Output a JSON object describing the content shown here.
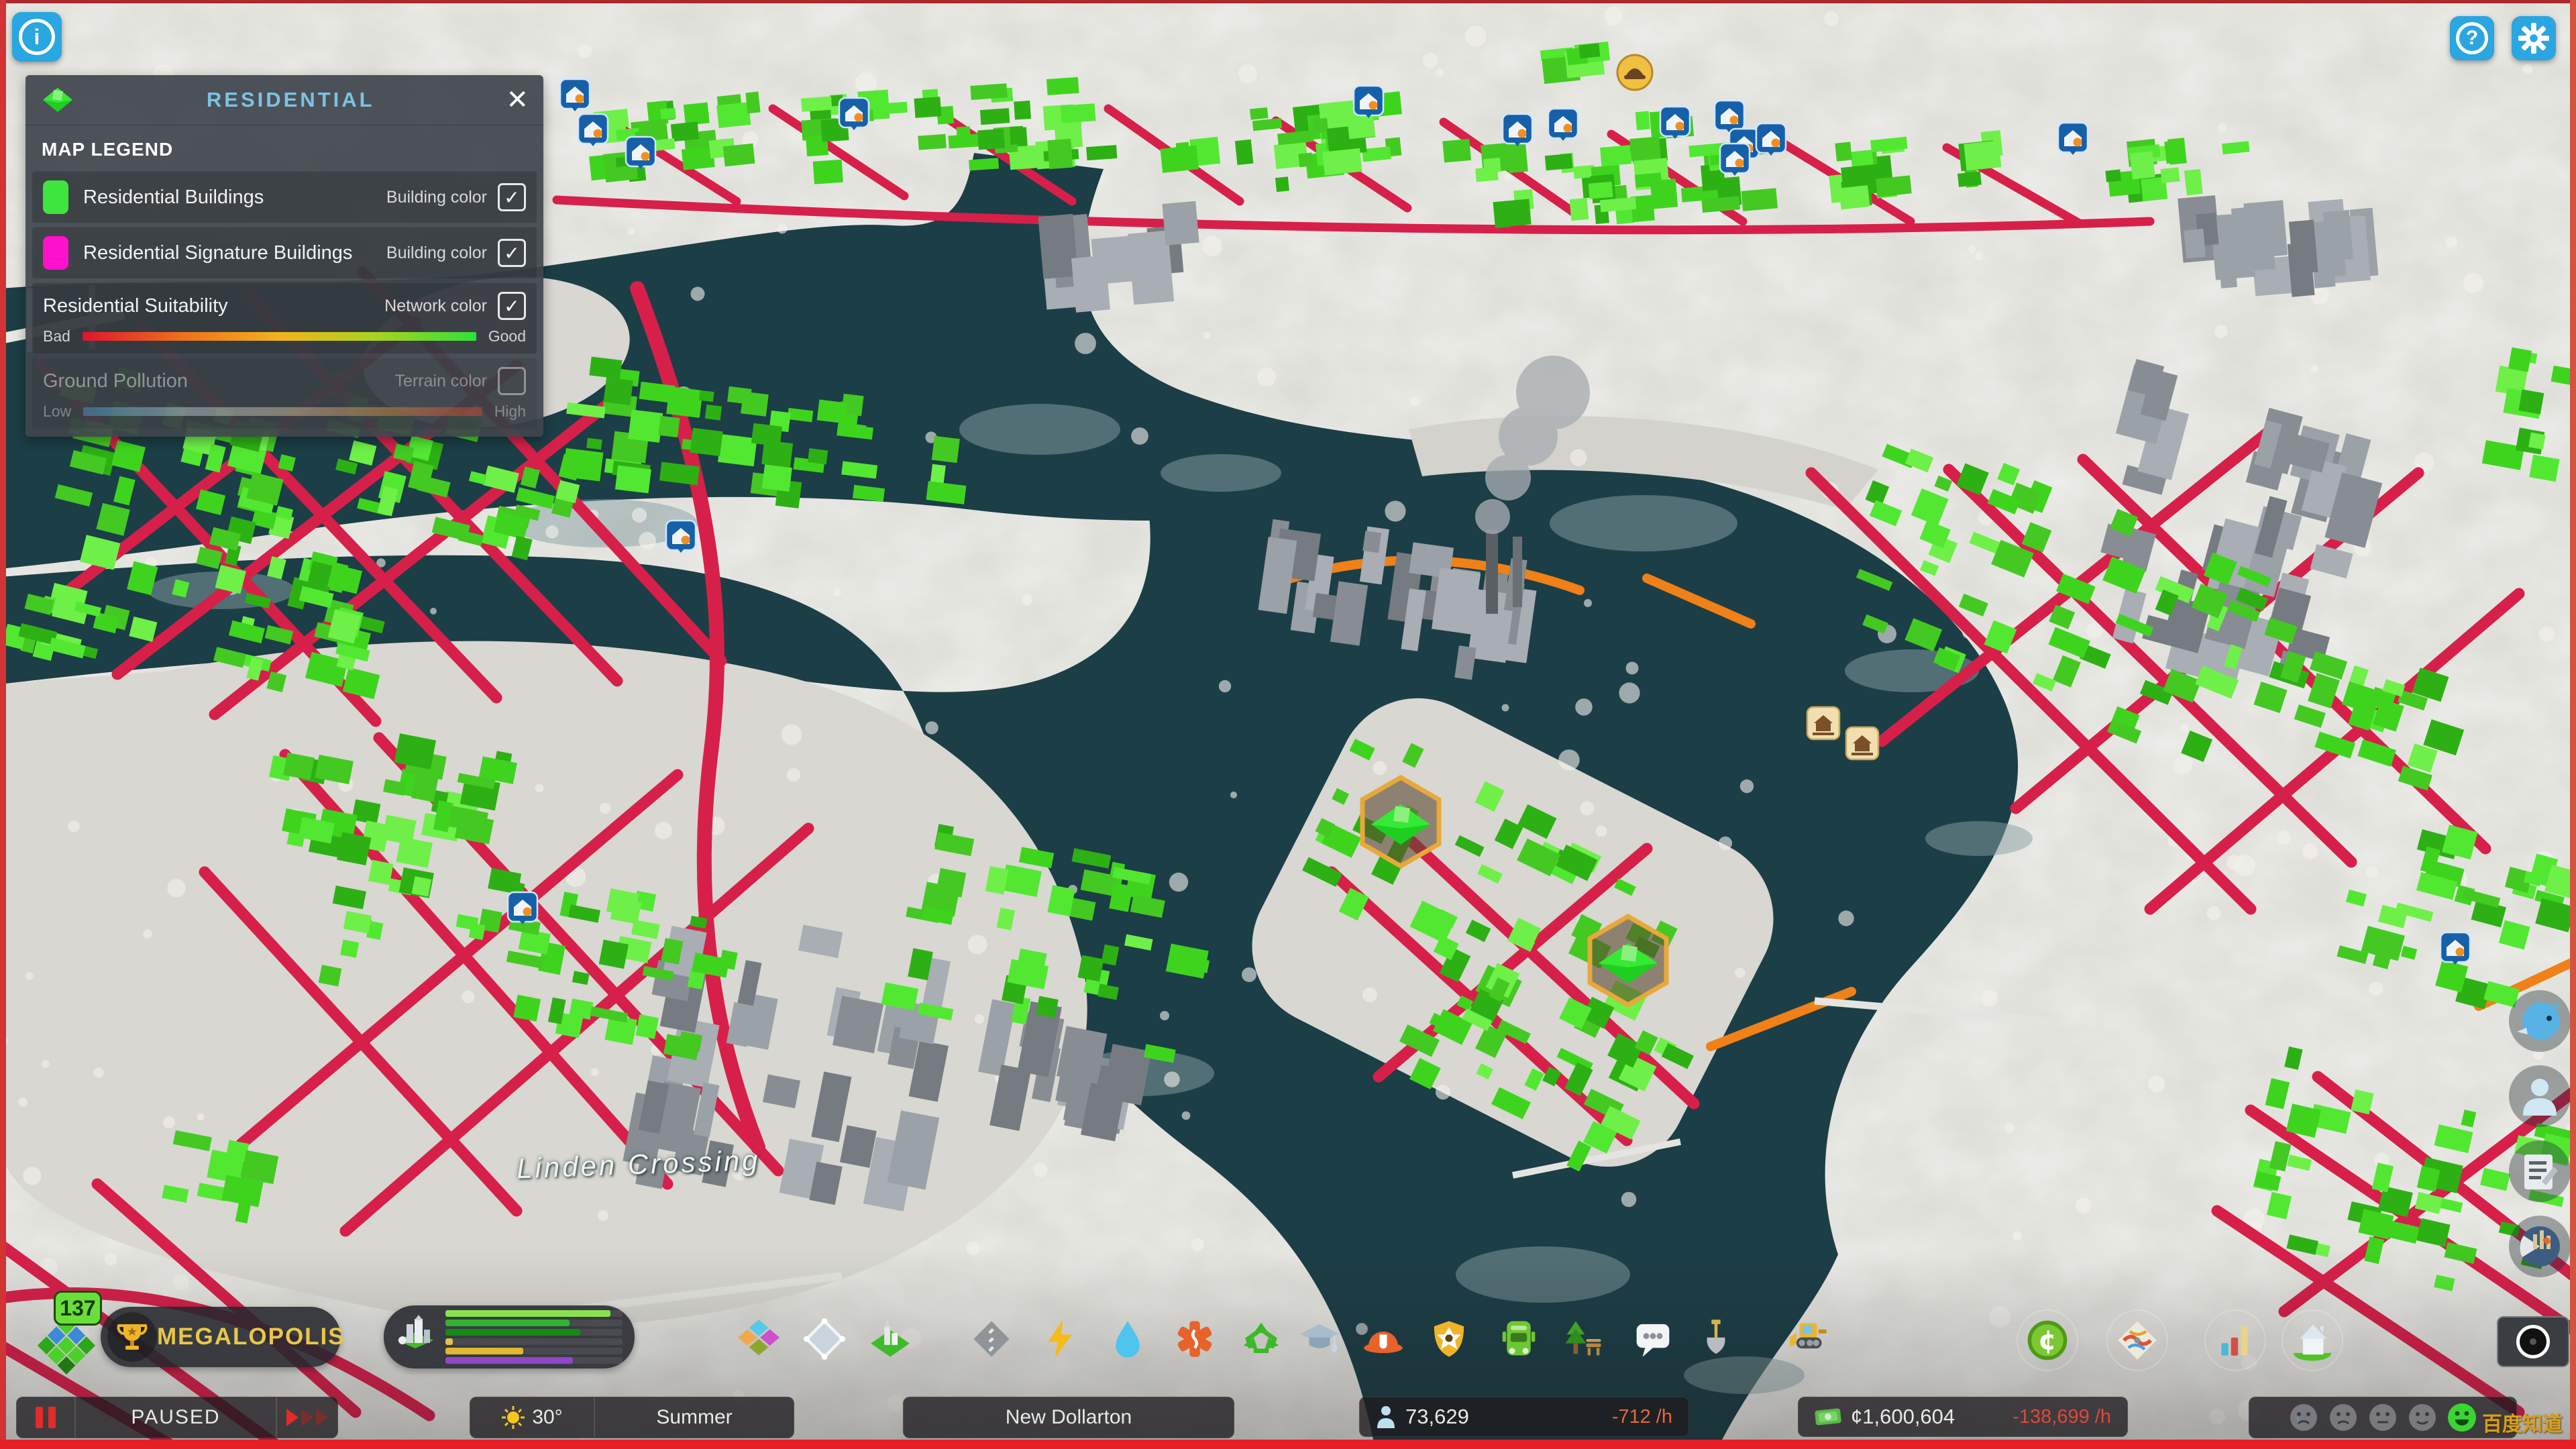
{
  "infoview_panel": {
    "title": "RESIDENTIAL",
    "section_heading": "MAP LEGEND",
    "close_glyph": "✕",
    "rows": {
      "r1": {
        "label": "Residential Buildings",
        "mode": "Building color",
        "check": "✓",
        "swatch": "#3fe53f"
      },
      "r2": {
        "label": "Residential Signature Buildings",
        "mode": "Building color",
        "check": "✓",
        "swatch": "#ff10cc"
      },
      "r3": {
        "label": "Residential Suitability",
        "mode": "Network color",
        "check": "✓",
        "scale_left": "Bad",
        "scale_right": "Good",
        "gradient": [
          "#de1530",
          "#ee6f1c",
          "#f2b31c",
          "#a6d41e",
          "#2fe03c"
        ]
      },
      "r4": {
        "label": "Ground Pollution",
        "mode": "Terrain color",
        "check": "",
        "scale_left": "Low",
        "scale_right": "High",
        "gradient": [
          "#3a9ad0",
          "#bdd2d8",
          "#d8c9a8",
          "#d98a40",
          "#d23c28"
        ]
      }
    }
  },
  "top_buttons": {
    "info_glyph": "i",
    "help_glyph": "?"
  },
  "map": {
    "district_label": "Linden Crossing"
  },
  "toolbar": {
    "tiles_count": "137",
    "milestone_label": "MEGALOPOLIS"
  },
  "demand": {
    "bars": [
      {
        "name": "residential-low",
        "color": "#86e24e",
        "value": 0.93
      },
      {
        "name": "residential-medium",
        "color": "#2fb52f",
        "value": 0.7
      },
      {
        "name": "residential-high",
        "color": "#168a16",
        "value": 0.76
      },
      {
        "name": "commercial",
        "color": "#d8c44e",
        "value": 0.04
      },
      {
        "name": "industrial",
        "color": "#e0b832",
        "value": 0.44
      },
      {
        "name": "office",
        "color": "#8f46c8",
        "value": 0.72
      }
    ]
  },
  "statusbar": {
    "paused_label": "PAUSED",
    "temperature": "30°",
    "season": "Summer",
    "city_name": "New Dollarton",
    "population": "73,629",
    "population_rate": "-712 /h",
    "money": "¢1,600,604",
    "money_rate": "-138,699 /h"
  },
  "colors": {
    "accent_blue": "#2aa6e0",
    "road_highlight": "#d6204a",
    "zone_green": "#3ed41e",
    "water": "#1c3e46",
    "milestone_gold": "#e8c64a"
  },
  "watermark": "百度知道"
}
